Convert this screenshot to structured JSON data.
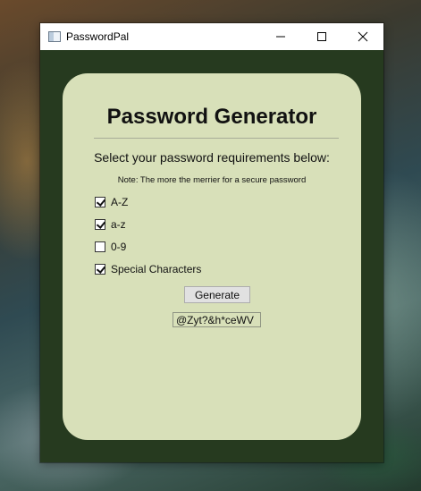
{
  "window": {
    "title": "PasswordPal",
    "controls": {
      "minimize": "minimize-icon",
      "maximize": "maximize-icon",
      "close": "close-icon"
    }
  },
  "colors": {
    "window_background": "#263a1f",
    "card_background": "#d8e0b9"
  },
  "main": {
    "heading": "Password Generator",
    "subtitle": "Select your password requirements below:",
    "note": "Note: The more the merrier for a secure password",
    "options": [
      {
        "label": "A-Z",
        "checked": true
      },
      {
        "label": "a-z",
        "checked": true
      },
      {
        "label": "0-9",
        "checked": false
      },
      {
        "label": "Special Characters",
        "checked": true
      }
    ],
    "generate_label": "Generate",
    "output_value": "@Zyt?&h*ceWV"
  }
}
